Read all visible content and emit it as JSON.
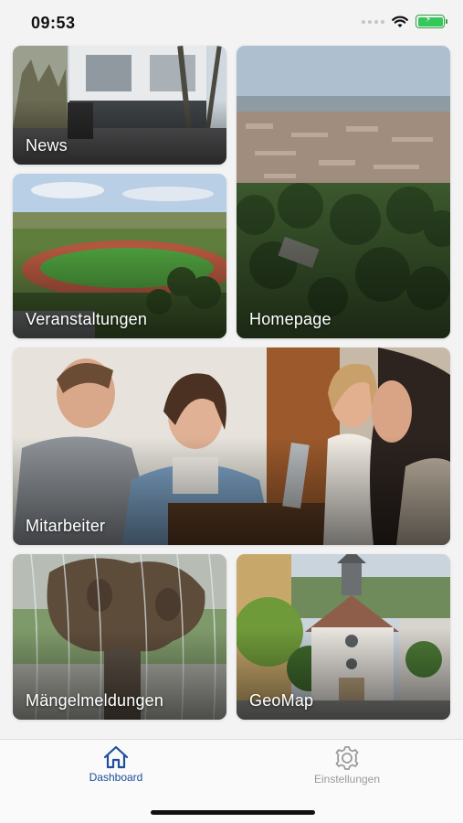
{
  "status_bar": {
    "time": "09:53",
    "icons": [
      "signal-dots-icon",
      "wifi-icon",
      "battery-charging-icon"
    ],
    "battery_color": "#34c759"
  },
  "tiles": [
    {
      "id": "news",
      "label": "News",
      "image": "school-building-photo"
    },
    {
      "id": "homepage",
      "label": "Homepage",
      "image": "aerial-town-view-photo"
    },
    {
      "id": "veranstaltungen",
      "label": "Veranstaltungen",
      "image": "sports-stadium-photo"
    },
    {
      "id": "mitarbeiter",
      "label": "Mitarbeiter",
      "image": "team-meeting-photo"
    },
    {
      "id": "maengel",
      "label": "Mängelmeldungen",
      "image": "fountain-sculpture-photo"
    },
    {
      "id": "geomap",
      "label": "GeoMap",
      "image": "town-church-street-photo"
    }
  ],
  "tab_bar": {
    "dashboard_label": "Dashboard",
    "settings_label": "Einstellungen",
    "active_tab": "Dashboard",
    "active_color": "#1f4e9c",
    "inactive_color": "#9a9a9a"
  }
}
